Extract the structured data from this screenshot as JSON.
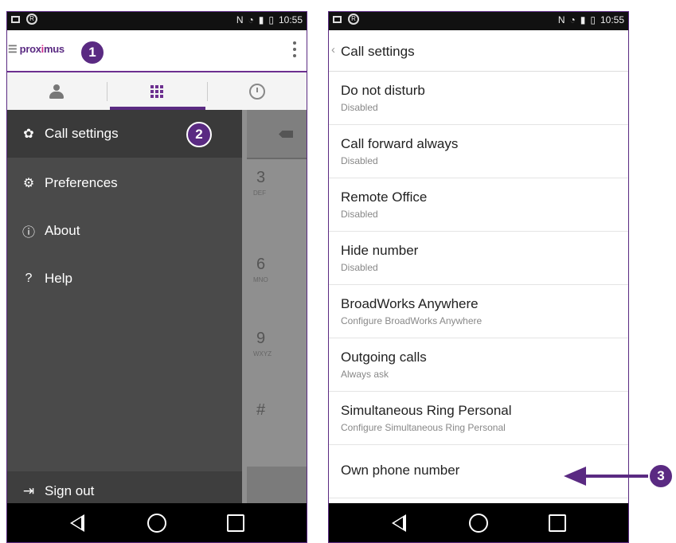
{
  "status_bar": {
    "time": "10:55",
    "nfc": "N"
  },
  "left_screen": {
    "logo": {
      "prefix": "prox",
      "mark": "i",
      "suffix": "mus"
    },
    "drawer_items": [
      {
        "label": "Call settings",
        "icon": "gear-icon"
      },
      {
        "label": "Preferences",
        "icon": "gears-icon"
      },
      {
        "label": "About",
        "icon": "info-icon"
      },
      {
        "label": "Help",
        "icon": "question-icon"
      }
    ],
    "sign_out": "Sign out",
    "dialer": {
      "digits": [
        {
          "digit": "3",
          "letters": "DEF"
        },
        {
          "digit": "6",
          "letters": "MNO"
        },
        {
          "digit": "9",
          "letters": "WXYZ"
        },
        {
          "digit": "#",
          "letters": ""
        }
      ]
    }
  },
  "right_screen": {
    "title": "Call settings",
    "items": [
      {
        "title": "Do not disturb",
        "subtitle": "Disabled"
      },
      {
        "title": "Call forward always",
        "subtitle": "Disabled"
      },
      {
        "title": "Remote Office",
        "subtitle": "Disabled"
      },
      {
        "title": "Hide number",
        "subtitle": "Disabled"
      },
      {
        "title": "BroadWorks Anywhere",
        "subtitle": "Configure BroadWorks Anywhere"
      },
      {
        "title": "Outgoing calls",
        "subtitle": "Always ask"
      },
      {
        "title": "Simultaneous Ring Personal",
        "subtitle": "Configure Simultaneous Ring Personal"
      },
      {
        "title": "Own phone number",
        "subtitle": ""
      }
    ]
  },
  "callouts": {
    "one": "1",
    "two": "2",
    "three": "3"
  },
  "colors": {
    "accent": "#5a2a82",
    "drawer": "#4a4a4a"
  }
}
